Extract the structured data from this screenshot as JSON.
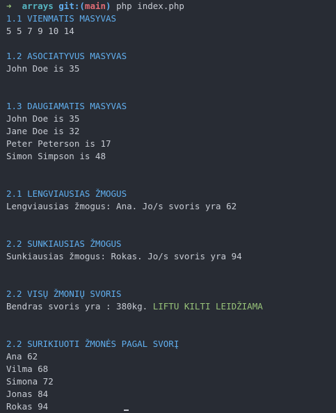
{
  "prompt": {
    "arrow": "➜",
    "dir": "arrays",
    "git_label": "git:(",
    "branch": "main",
    "git_close": ")",
    "command": "php index.php"
  },
  "output": {
    "s1_heading": "1.1 VIENMATIS MASYVAS",
    "s1_values": "5 5 7 9 10 14",
    "s2_heading": "1.2 ASOCIATYVUS MASYVAS",
    "s2_line": "John Doe is 35",
    "s3_heading": "1.3 DAUGIAMATIS MASYVAS",
    "s3_lines": [
      "John Doe is 35",
      "Jane Doe is 32",
      "Peter Peterson is 17",
      "Simon Simpson is 48"
    ],
    "s4_heading": "2.1 LENGVIAUSIAS ŽMOGUS",
    "s4_line": "Lengviausias žmogus: Ana. Jo/s svoris yra 62",
    "s5_heading": "2.2 SUNKIAUSIAS ŽMOGUS",
    "s5_line": "Sunkiausias žmogus: Rokas. Jo/s svoris yra 94",
    "s6_heading": "2.2 VISŲ ŽMONIŲ SVORIS",
    "s6_text": "Bendras svoris yra : 380kg. ",
    "s6_status": "LIFTU KILTI LEIDŽIAMA",
    "s7_heading": "2.2 SURIKIUOTI ŽMONĖS PAGAL SVORĮ",
    "s7_lines": [
      "Ana 62",
      "Vilma 68",
      "Simona 72",
      "Jonas 84",
      "Rokas 94"
    ]
  }
}
